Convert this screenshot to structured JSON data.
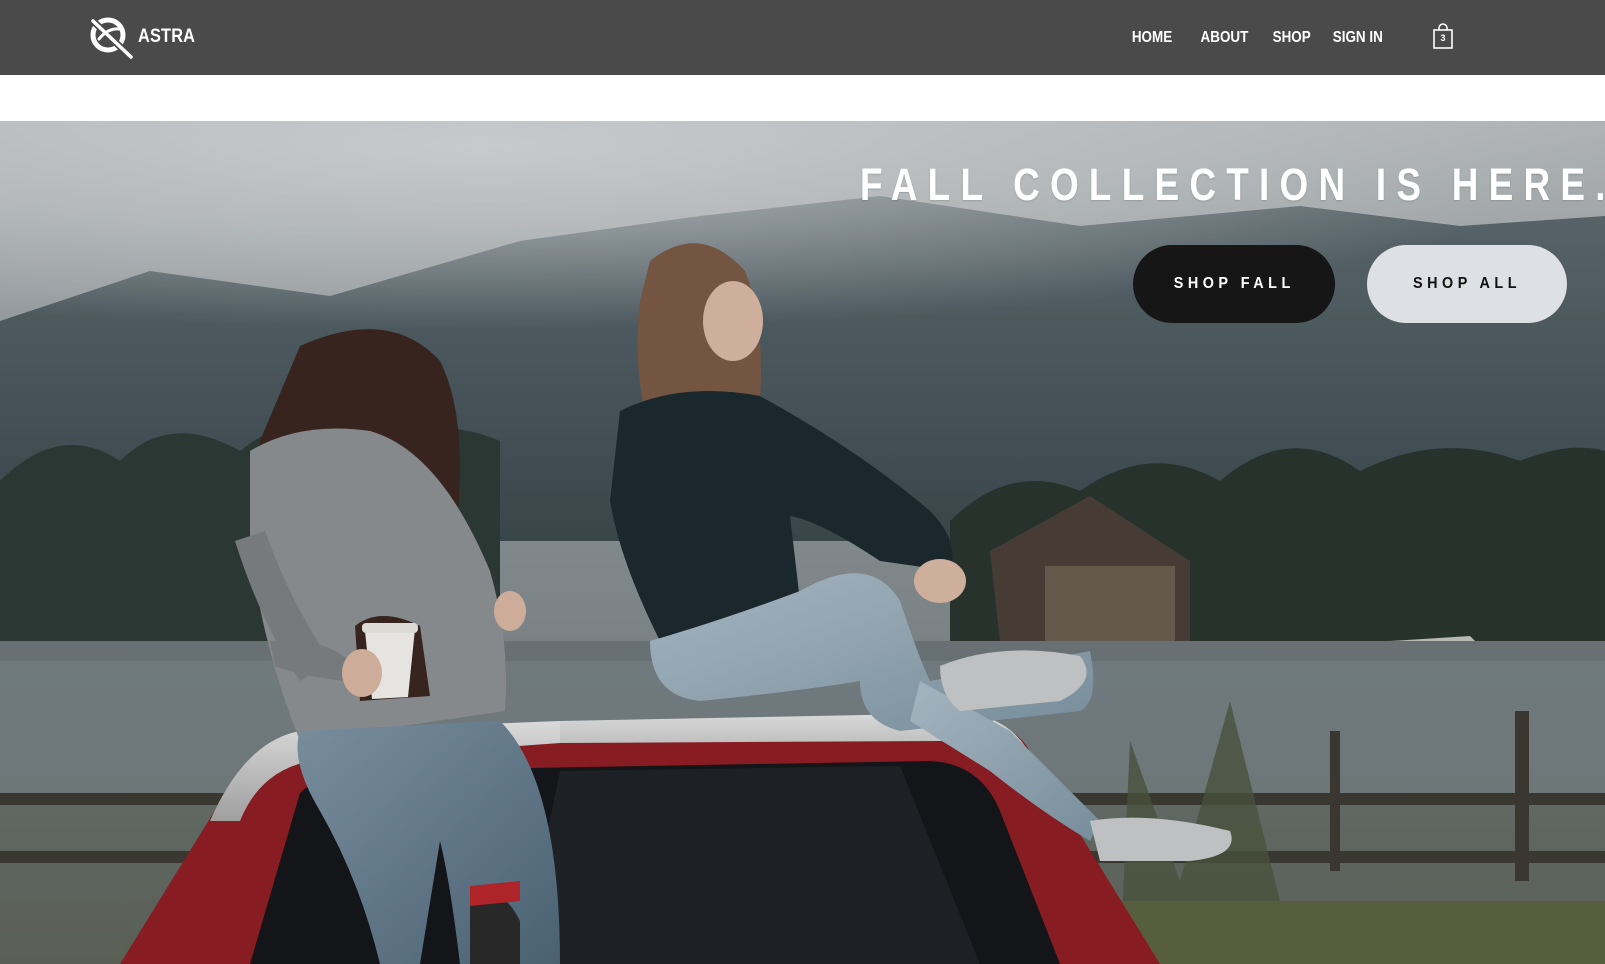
{
  "brand": {
    "name": "ASTRA",
    "logo_icon": "astra-logo-icon"
  },
  "nav": {
    "items": [
      {
        "label": "HOME"
      },
      {
        "label": "ABOUT"
      },
      {
        "label": "SHOP"
      },
      {
        "label": "SIGN IN"
      }
    ],
    "cart": {
      "icon": "shopping-bag-icon",
      "count": "3"
    }
  },
  "hero": {
    "title": "FALL COLLECTION IS HERE.",
    "buttons": {
      "shop_fall": "SHOP FALL",
      "shop_all": "SHOP ALL"
    }
  },
  "colors": {
    "navbar_bg": "#4a4a4a",
    "shop_fall_bg": "#161616",
    "shop_all_bg": "#dde0e4"
  }
}
